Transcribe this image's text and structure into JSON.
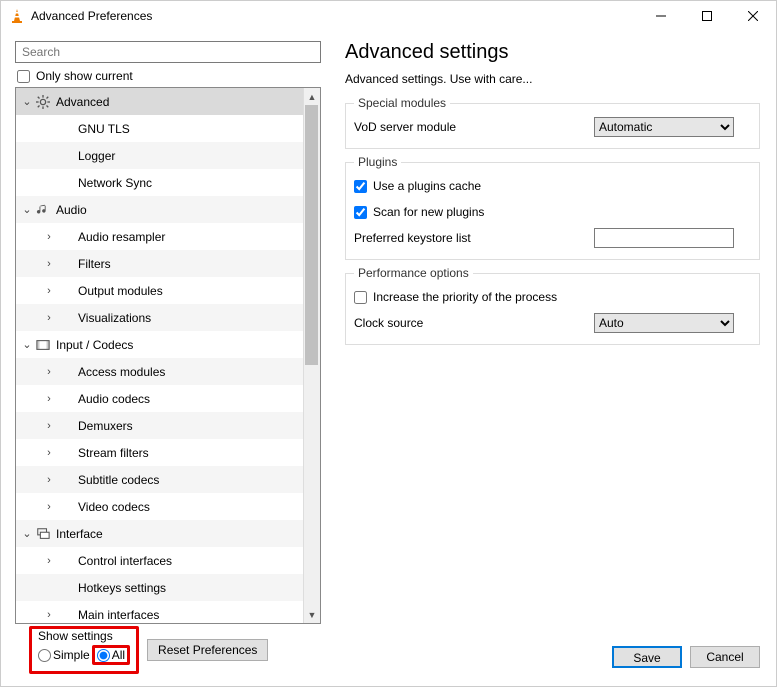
{
  "window": {
    "title": "Advanced Preferences"
  },
  "search": {
    "placeholder": "Search"
  },
  "onlyShowCurrent": {
    "label": "Only show current",
    "checked": false
  },
  "tree": {
    "items": [
      {
        "depth": 0,
        "chevron": "down",
        "icon": "gear",
        "label": "Advanced",
        "sel": true
      },
      {
        "depth": 1,
        "chevron": "",
        "icon": "",
        "label": "GNU TLS"
      },
      {
        "depth": 1,
        "chevron": "",
        "icon": "",
        "label": "Logger"
      },
      {
        "depth": 1,
        "chevron": "",
        "icon": "",
        "label": "Network Sync"
      },
      {
        "depth": 0,
        "chevron": "down",
        "icon": "audio",
        "label": "Audio"
      },
      {
        "depth": 1,
        "chevron": "right",
        "icon": "",
        "label": "Audio resampler"
      },
      {
        "depth": 1,
        "chevron": "right",
        "icon": "",
        "label": "Filters"
      },
      {
        "depth": 1,
        "chevron": "right",
        "icon": "",
        "label": "Output modules"
      },
      {
        "depth": 1,
        "chevron": "right",
        "icon": "",
        "label": "Visualizations"
      },
      {
        "depth": 0,
        "chevron": "down",
        "icon": "codec",
        "label": "Input / Codecs"
      },
      {
        "depth": 1,
        "chevron": "right",
        "icon": "",
        "label": "Access modules"
      },
      {
        "depth": 1,
        "chevron": "right",
        "icon": "",
        "label": "Audio codecs"
      },
      {
        "depth": 1,
        "chevron": "right",
        "icon": "",
        "label": "Demuxers"
      },
      {
        "depth": 1,
        "chevron": "right",
        "icon": "",
        "label": "Stream filters"
      },
      {
        "depth": 1,
        "chevron": "right",
        "icon": "",
        "label": "Subtitle codecs"
      },
      {
        "depth": 1,
        "chevron": "right",
        "icon": "",
        "label": "Video codecs"
      },
      {
        "depth": 0,
        "chevron": "down",
        "icon": "iface",
        "label": "Interface"
      },
      {
        "depth": 1,
        "chevron": "right",
        "icon": "",
        "label": "Control interfaces"
      },
      {
        "depth": 1,
        "chevron": "",
        "icon": "",
        "label": "Hotkeys settings"
      },
      {
        "depth": 1,
        "chevron": "right",
        "icon": "",
        "label": "Main interfaces"
      }
    ]
  },
  "showSettings": {
    "legend": "Show settings",
    "simpleLabel": "Simple",
    "allLabel": "All",
    "selected": "all"
  },
  "resetButton": "Reset Preferences",
  "main": {
    "heading": "Advanced settings",
    "subheading": "Advanced settings. Use with care...",
    "groups": {
      "specialModules": {
        "legend": "Special modules",
        "vodLabel": "VoD server module",
        "vodValue": "Automatic"
      },
      "plugins": {
        "legend": "Plugins",
        "cacheLabel": "Use a plugins cache",
        "cacheChecked": true,
        "scanLabel": "Scan for new plugins",
        "scanChecked": true,
        "keystoreLabel": "Preferred keystore list",
        "keystoreValue": ""
      },
      "perf": {
        "legend": "Performance options",
        "priorityLabel": "Increase the priority of the process",
        "priorityChecked": false,
        "clockLabel": "Clock source",
        "clockValue": "Auto"
      }
    }
  },
  "buttons": {
    "save": "Save",
    "cancel": "Cancel"
  }
}
